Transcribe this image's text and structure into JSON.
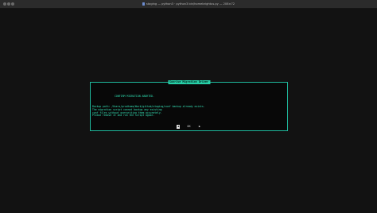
{
  "window": {
    "title": "staging — python3 · python3 bin/homebrightus.py — 208×72"
  },
  "dialog": {
    "title": "Sunrise Migration Driver",
    "heading": "CONFIRM MIGRATION ABORTED.",
    "lines": [
      "Backup path: /Users/prodteam/Work/github/staging/conf backup already exists.",
      "The migration script cannot backup any existing",
      "conf files without overwriting them accurately.",
      "Please remove it and run the script again."
    ],
    "buttons": [
      "◀",
      "OK",
      "▶"
    ]
  }
}
